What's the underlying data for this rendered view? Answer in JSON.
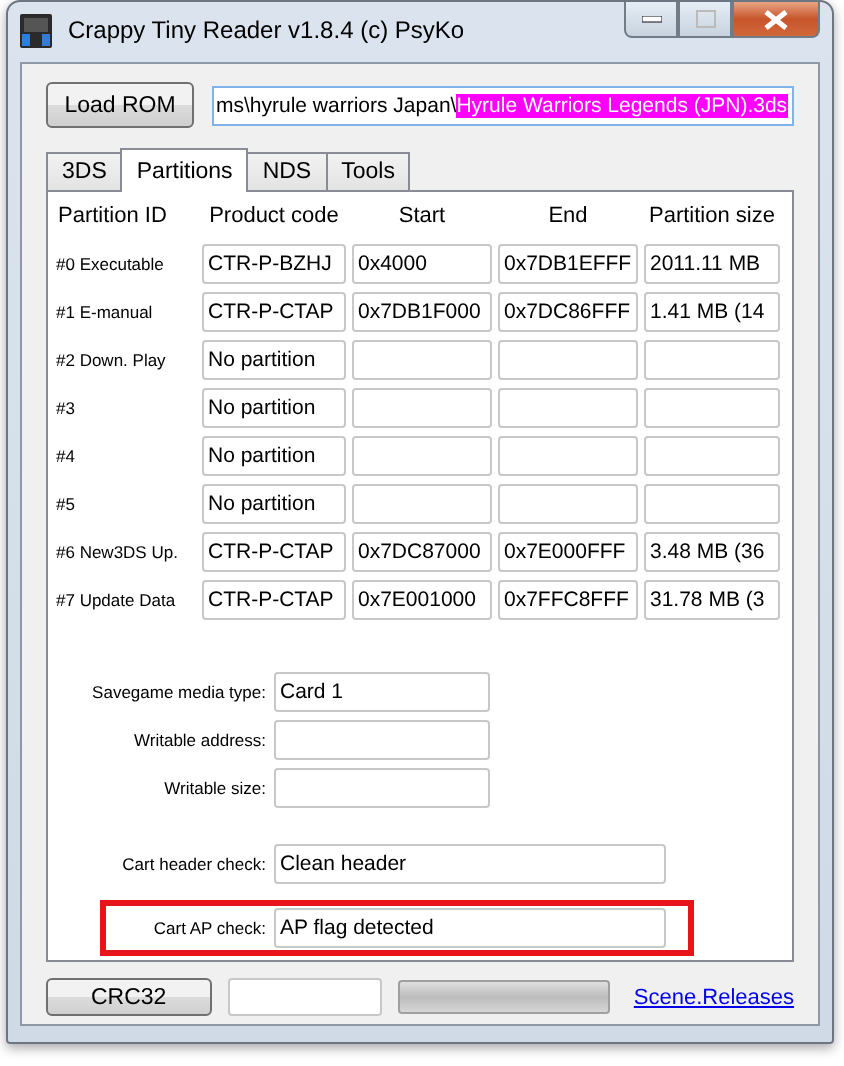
{
  "window": {
    "title": "Crappy Tiny Reader v1.8.4 (c) PsyKo"
  },
  "load_button": "Load ROM",
  "path_field": {
    "value": "ms\\hyrule warriors Japan\\",
    "selected_value": "Hyrule Warriors Legends (JPN).3ds"
  },
  "tabs": [
    {
      "label": "3DS",
      "selected": false
    },
    {
      "label": "Partitions",
      "selected": true
    },
    {
      "label": "NDS",
      "selected": false
    },
    {
      "label": "Tools",
      "selected": false
    }
  ],
  "partitions": {
    "columns": [
      "Partition ID",
      "Product code",
      "Start",
      "End",
      "Partition size"
    ],
    "rows": [
      {
        "id": "#0 Executable",
        "product_code": "CTR-P-BZHJ",
        "start": "0x4000",
        "end": "0x7DB1EFFF",
        "size": "2011.11 MB"
      },
      {
        "id": "#1 E-manual",
        "product_code": "CTR-P-CTAP",
        "start": "0x7DB1F000",
        "end": "0x7DC86FFF",
        "size": "1.41 MB (14"
      },
      {
        "id": "#2 Down. Play",
        "product_code": "No partition"
      },
      {
        "id": "#3",
        "product_code": "No partition"
      },
      {
        "id": "#4",
        "product_code": "No partition"
      },
      {
        "id": "#5",
        "product_code": "No partition"
      },
      {
        "id": "#6 New3DS Up.",
        "product_code": "CTR-P-CTAP",
        "start": "0x7DC87000",
        "end": "0x7E000FFF",
        "size": "3.48 MB (36"
      },
      {
        "id": "#7 Update Data",
        "product_code": "CTR-P-CTAP",
        "start": "0x7E001000",
        "end": "0x7FFC8FFF",
        "size": "31.78 MB (3"
      }
    ]
  },
  "savegame": [
    {
      "label": "Savegame media type:",
      "value": "Card 1"
    },
    {
      "label": "Writable address:"
    },
    {
      "label": "Writable size:"
    }
  ],
  "checks": [
    {
      "label": "Cart header check:",
      "value": "Clean header",
      "highlighted": false
    },
    {
      "label": "Cart AP check:",
      "value": "AP flag detected",
      "highlighted": true
    }
  ],
  "footer": {
    "crc_button": "CRC32",
    "link": "Scene.Releases"
  }
}
